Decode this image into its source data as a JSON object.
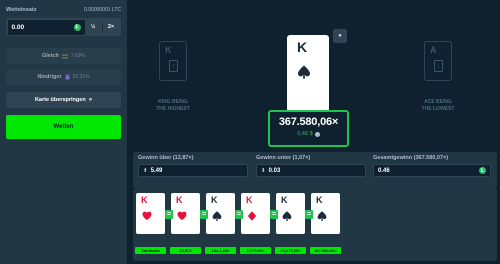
{
  "sidebar": {
    "bet_label": "Wetteinsatz",
    "bet_crypto": "0.00000001 LTC",
    "bet_value": "0.00",
    "coin_symbol": "Ł",
    "half_label": "½",
    "double_label": "2×",
    "higher_label": "Gleich",
    "higher_icon": "equals-icon",
    "higher_pct": "7,69%",
    "lower_label": "Niedriger",
    "lower_icon": "down-icon",
    "lower_pct": "92,31%",
    "skip_label": "Karte überspringen",
    "skip_icon": "double-chevron-icon",
    "play_label": "Wetten"
  },
  "game": {
    "left_ghost_rank": "K",
    "left_caption_line1": "KING BEING",
    "left_caption_line2": "THE HIGHEST",
    "right_ghost_rank": "A",
    "right_caption_line1": "ACE BEING",
    "right_caption_line2": "THE LOWEST",
    "main_card_rank": "K",
    "main_card_suit": "spade",
    "skip_small_icon": "double-chevron-icon",
    "payout_multiplier": "367.580,06×",
    "payout_amount": "0,46 $"
  },
  "stats": {
    "over_label": "Gewinn über (12,87×)",
    "over_value": "5.49",
    "under_label": "Gewinn unter (1,07×)",
    "under_value": "0.03",
    "total_label": "Gesamtgewinn (367.580,07×)",
    "total_value": "0.46"
  },
  "history": [
    {
      "rank": "K",
      "suit": "heart",
      "tag": "Startkarte"
    },
    {
      "rank": "K",
      "suit": "heart",
      "tag": "13,57×"
    },
    {
      "rank": "K",
      "suit": "spade",
      "tag": "184,1,23×"
    },
    {
      "rank": "K",
      "suit": "diamond",
      "tag": "2,375,00×"
    },
    {
      "rank": "K",
      "suit": "spade",
      "tag": "28,275,00×"
    },
    {
      "rank": "K",
      "suit": "spade",
      "tag": "367.580,06×"
    }
  ],
  "colors": {
    "accent_green": "#00e701",
    "payout_green": "#1fc44e",
    "sidebar_bg": "#213743",
    "game_bg": "#0f212e",
    "red_suit": "#e9113c",
    "black_suit": "#1a2c38"
  }
}
